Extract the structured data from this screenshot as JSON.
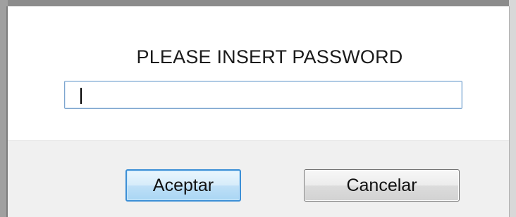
{
  "dialog": {
    "prompt": "PLEASE INSERT PASSWORD",
    "password_value": "",
    "buttons": {
      "accept_label": "Aceptar",
      "cancel_label": "Cancelar"
    }
  },
  "colors": {
    "accept_border": "#3c8fd6",
    "field_border": "#7ea6cf",
    "button_bar": "#f0f0f0",
    "frame": "#8c8c8c"
  }
}
